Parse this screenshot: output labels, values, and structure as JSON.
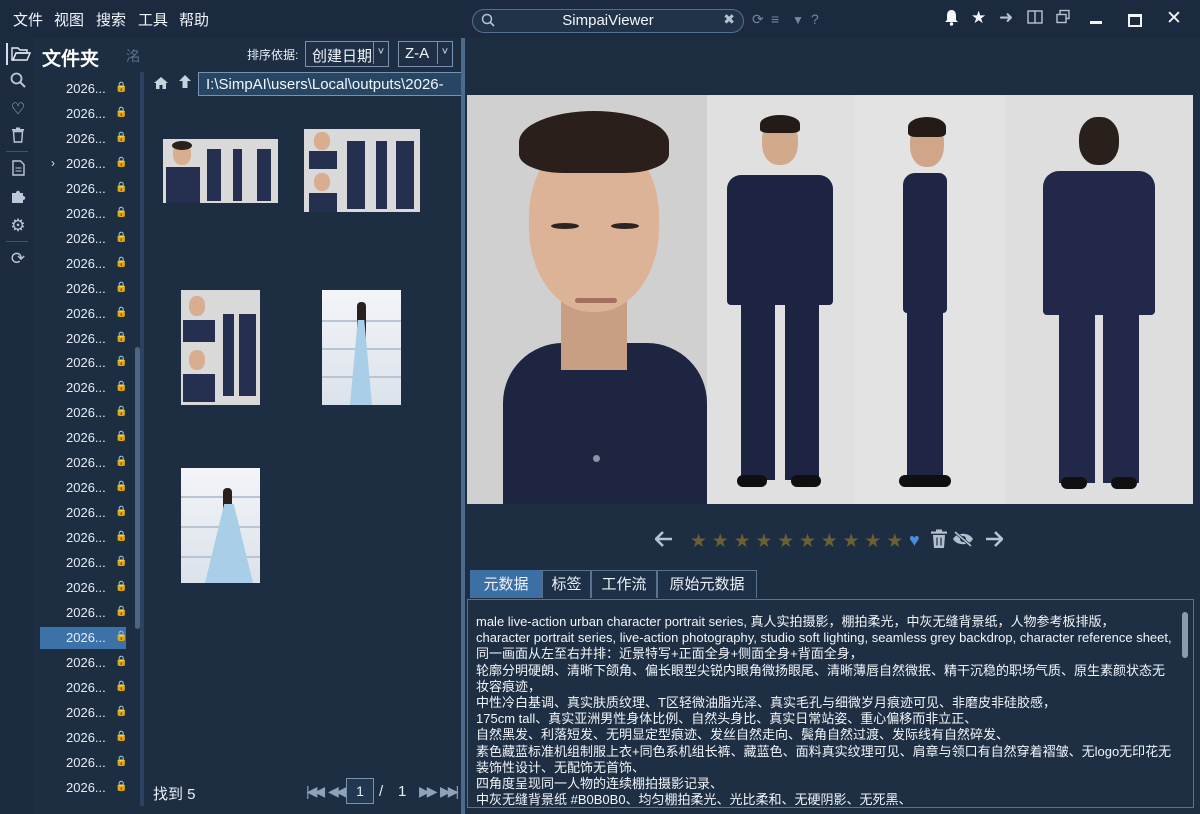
{
  "menu": [
    "文件",
    "视图",
    "搜索",
    "工具",
    "帮助"
  ],
  "app": {
    "title": "SimpaiViewer"
  },
  "window_icons": [
    "bell-icon",
    "star-icon",
    "forward-icon",
    "panel-icon",
    "restore-icon",
    "minimize-icon",
    "maximize-icon",
    "close-icon"
  ],
  "folder_panel": {
    "title": "文件夹",
    "extra": "洺"
  },
  "tree": {
    "items": [
      {
        "label": "2026...",
        "selected": false,
        "expandable": false
      },
      {
        "label": "2026...",
        "selected": false,
        "expandable": false
      },
      {
        "label": "2026...",
        "selected": false,
        "expandable": false
      },
      {
        "label": "2026...",
        "selected": false,
        "expandable": true
      },
      {
        "label": "2026...",
        "selected": false,
        "expandable": false
      },
      {
        "label": "2026...",
        "selected": false,
        "expandable": false
      },
      {
        "label": "2026...",
        "selected": false,
        "expandable": false
      },
      {
        "label": "2026...",
        "selected": false,
        "expandable": false
      },
      {
        "label": "2026...",
        "selected": false,
        "expandable": false
      },
      {
        "label": "2026...",
        "selected": false,
        "expandable": false
      },
      {
        "label": "2026...",
        "selected": false,
        "expandable": false
      },
      {
        "label": "2026...",
        "selected": false,
        "expandable": false
      },
      {
        "label": "2026...",
        "selected": false,
        "expandable": false
      },
      {
        "label": "2026...",
        "selected": false,
        "expandable": false
      },
      {
        "label": "2026...",
        "selected": false,
        "expandable": false
      },
      {
        "label": "2026...",
        "selected": false,
        "expandable": false
      },
      {
        "label": "2026...",
        "selected": false,
        "expandable": false
      },
      {
        "label": "2026...",
        "selected": false,
        "expandable": false
      },
      {
        "label": "2026...",
        "selected": false,
        "expandable": false
      },
      {
        "label": "2026...",
        "selected": false,
        "expandable": false
      },
      {
        "label": "2026...",
        "selected": false,
        "expandable": false
      },
      {
        "label": "2026...",
        "selected": false,
        "expandable": false
      },
      {
        "label": "2026...",
        "selected": true,
        "expandable": false
      },
      {
        "label": "2026...",
        "selected": false,
        "expandable": false
      },
      {
        "label": "2026...",
        "selected": false,
        "expandable": false
      },
      {
        "label": "2026...",
        "selected": false,
        "expandable": false
      },
      {
        "label": "2026...",
        "selected": false,
        "expandable": false
      },
      {
        "label": "2026...",
        "selected": false,
        "expandable": false
      },
      {
        "label": "2026...",
        "selected": false,
        "expandable": false
      }
    ]
  },
  "sort": {
    "label": "排序依据:",
    "field": "创建日期",
    "order": "Z-A"
  },
  "path": {
    "value": "I:\\SimpAI\\users\\Local\\outputs\\2026-"
  },
  "thumbnails": [
    "character-sheet",
    "character-sheet",
    "character-sheet",
    "hall-portrait",
    "hall-portrait"
  ],
  "pager": {
    "found": "找到 5",
    "current": "1",
    "separator": "/",
    "total": "1"
  },
  "rating": {
    "filled": 0,
    "max": 10
  },
  "tabs": [
    {
      "label": "元数据",
      "active": true
    },
    {
      "label": "标签",
      "active": false
    },
    {
      "label": "工作流",
      "active": false
    },
    {
      "label": "原始元数据",
      "active": false
    }
  ],
  "metadata": {
    "text": "male live-action urban character portrait series, 真人实拍摄影，棚拍柔光，中灰无缝背景纸，人物参考板排版，\ncharacter portrait series, live-action photography, studio soft lighting, seamless grey backdrop, character reference sheet, 同一画面从左至右并排：近景特写+正面全身+侧面全身+背面全身，\n轮廓分明硬朗、清晰下颌角、偏长眼型尖锐内眼角微扬眼尾、清晰薄唇自然微抿、精干沉稳的职场气质、原生素颜状态无妆容痕迹，\n中性冷白基调、真实肤质纹理、T区轻微油脂光泽、真实毛孔与细微岁月痕迹可见、非磨皮非硅胶感，\n175cm tall、真实亚洲男性身体比例、自然头身比、真实日常站姿、重心偏移而非立正、\n自然黑发、利落短发、无明显定型痕迹、发丝自然走向、鬓角自然过渡、发际线有自然碎发、\n素色藏蓝标准机组制服上衣+同色系机组长裤、藏蓝色、面料真实纹理可见、肩章与领口有自然穿着褶皱、无logo无印花无装饰性设计、无配饰无首饰、\n四角度呈现同一人物的连续棚拍摄影记录、\n中灰无缝背景纸 #B0B0B0、均匀棚拍柔光、光比柔和、无硬阴影、无死黑、"
  },
  "colors": {
    "accent": "#3c72a8",
    "background": "#1d2d42",
    "star_empty": "#6a6033",
    "heart": "#4a8de0"
  }
}
